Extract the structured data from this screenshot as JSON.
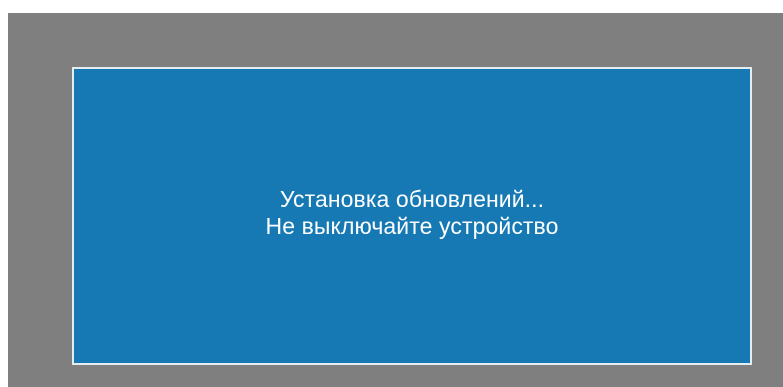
{
  "update_screen": {
    "line1": "Установка обновлений...",
    "line2": "Не выключайте устройство"
  },
  "colors": {
    "outer_background": "#7f7f7f",
    "screen_background": "#1679b4",
    "screen_border": "#e6edf2",
    "text": "#ffffff"
  }
}
